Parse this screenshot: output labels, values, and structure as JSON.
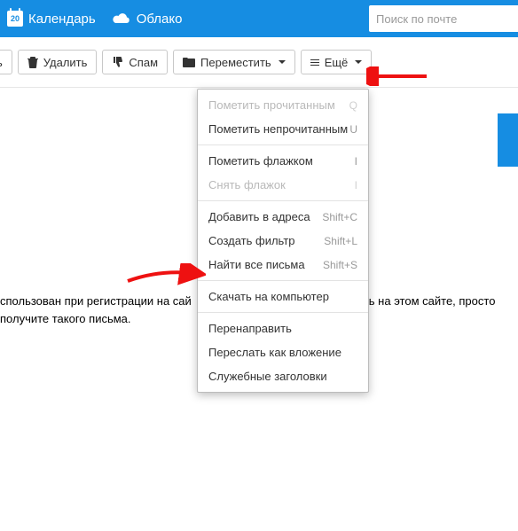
{
  "topbar": {
    "calendar": {
      "label": "Календарь",
      "day": "20"
    },
    "cloud": {
      "label": "Облако"
    },
    "search_placeholder": "Поиск по почте"
  },
  "toolbar": {
    "frag_btn": "ь",
    "delete": "Удалить",
    "spam": "Спам",
    "move": "Переместить",
    "more": "Ещё"
  },
  "dropdown": {
    "items": [
      {
        "label": "Пометить прочитанным",
        "key": "Q",
        "disabled": true
      },
      {
        "label": "Пометить непрочитанным",
        "key": "U",
        "disabled": false
      },
      {
        "sep": true
      },
      {
        "label": "Пометить флажком",
        "key": "I",
        "disabled": false
      },
      {
        "label": "Снять флажок",
        "key": "I",
        "disabled": true
      },
      {
        "sep": true
      },
      {
        "label": "Добавить в адреса",
        "key": "Shift+C",
        "disabled": false
      },
      {
        "label": "Создать фильтр",
        "key": "Shift+L",
        "disabled": false
      },
      {
        "label": "Найти все письма",
        "key": "Shift+S",
        "disabled": false
      },
      {
        "sep": true
      },
      {
        "label": "Скачать на компьютер",
        "key": "",
        "disabled": false
      },
      {
        "sep": true
      },
      {
        "label": "Перенаправить",
        "key": "",
        "disabled": false
      },
      {
        "label": "Переслать как вложение",
        "key": "",
        "disabled": false
      },
      {
        "label": "Служебные заголовки",
        "key": "",
        "disabled": false
      }
    ]
  },
  "content": {
    "part1": "спользован при регистрации на сай",
    "part2": "ь на этом сайте, просто",
    "part3": "получите такого письма."
  },
  "colors": {
    "brand": "#168de2",
    "arrow": "#e11"
  }
}
